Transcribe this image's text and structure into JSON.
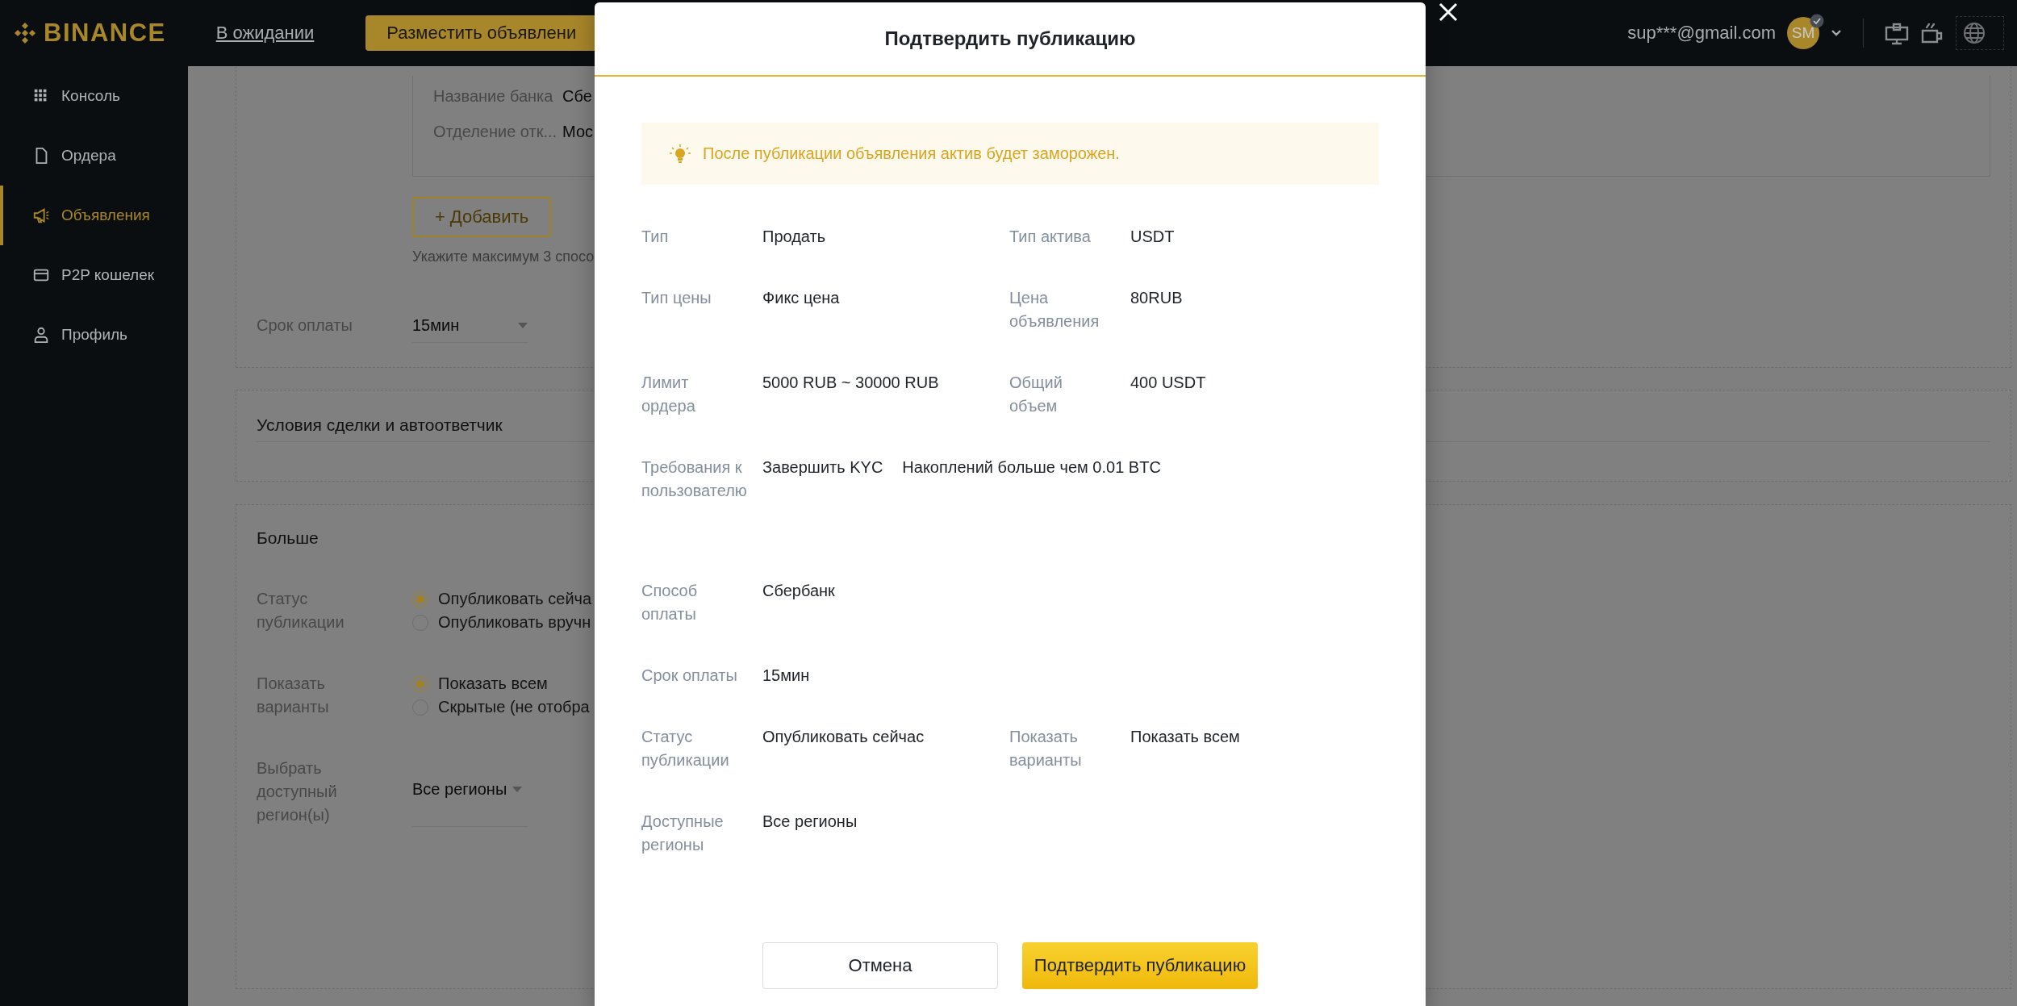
{
  "header": {
    "logo": "BINANCE",
    "pending_link": "В ожидании",
    "post_button": "Разместить объявлени",
    "email": "sup***@gmail.com",
    "avatar": "SM"
  },
  "sidebar": {
    "items": [
      {
        "label": "Консоль",
        "selected": false
      },
      {
        "label": "Ордера",
        "selected": false
      },
      {
        "label": "Объявления",
        "selected": true
      },
      {
        "label": "P2P кошелек",
        "selected": false
      },
      {
        "label": "Профиль",
        "selected": false
      }
    ]
  },
  "form": {
    "payment_card": {
      "fields": [
        {
          "label": "Название банка",
          "value": "Сбе"
        },
        {
          "label": "Отделение отк...",
          "value": "Мос"
        }
      ]
    },
    "add_button": "+ Добавить",
    "add_hint": "Укажите максимум 3 спосо",
    "payment_time": {
      "label": "Срок оплаты",
      "value": "15мин"
    },
    "terms_section": {
      "title": "Условия сделки и автоответчик"
    },
    "more_section": {
      "title": "Больше",
      "groups": [
        {
          "label": "Статус публикации",
          "options": [
            {
              "label": "Опубликовать сейча",
              "selected": true
            },
            {
              "label": "Опубликовать вручн",
              "selected": false
            }
          ]
        },
        {
          "label": "Показать варианты",
          "options": [
            {
              "label": "Показать всем",
              "selected": true
            },
            {
              "label": "Скрытые (не отобра",
              "selected": false
            }
          ]
        }
      ],
      "region": {
        "label": "Выбрать доступный регион(ы)",
        "value": "Все регионы"
      }
    }
  },
  "modal": {
    "title": "Подтвердить публикацию",
    "notice": "После публикации объявления актив будет заморожен.",
    "rows": [
      {
        "cells": [
          {
            "label": "Тип",
            "values": [
              "Продать"
            ]
          },
          {
            "label": "Тип актива",
            "values": [
              "USDT"
            ]
          }
        ]
      },
      {
        "cells": [
          {
            "label": "Тип цены",
            "values": [
              "Фикс цена"
            ]
          },
          {
            "label": "Цена объявления",
            "values": [
              "80RUB"
            ]
          }
        ]
      },
      {
        "cells": [
          {
            "label": "Лимит ордера",
            "values": [
              "5000 RUB ~ 30000 RUB"
            ]
          },
          {
            "label": "Общий объем",
            "values": [
              "400 USDT"
            ]
          }
        ]
      },
      {
        "cells": [
          {
            "label": "Требования к пользователю",
            "values": [
              "Завершить KYC",
              "Накоплений больше чем 0.01 BTC"
            ]
          }
        ]
      },
      {
        "cells": [
          {
            "label": "Способ оплаты",
            "values": [
              "Сбербанк"
            ]
          }
        ]
      },
      {
        "cells": [
          {
            "label": "Срок оплаты",
            "values": [
              "15мин"
            ]
          }
        ]
      },
      {
        "cells": [
          {
            "label": "Статус публикации",
            "values": [
              "Опубликовать сейчас"
            ]
          },
          {
            "label": "Показать варианты",
            "values": [
              "Показать всем"
            ]
          }
        ]
      },
      {
        "cells": [
          {
            "label": "Доступные регионы",
            "values": [
              "Все регионы"
            ]
          }
        ]
      }
    ],
    "buttons": {
      "cancel": "Отмена",
      "confirm": "Подтвердить публикацию"
    }
  }
}
